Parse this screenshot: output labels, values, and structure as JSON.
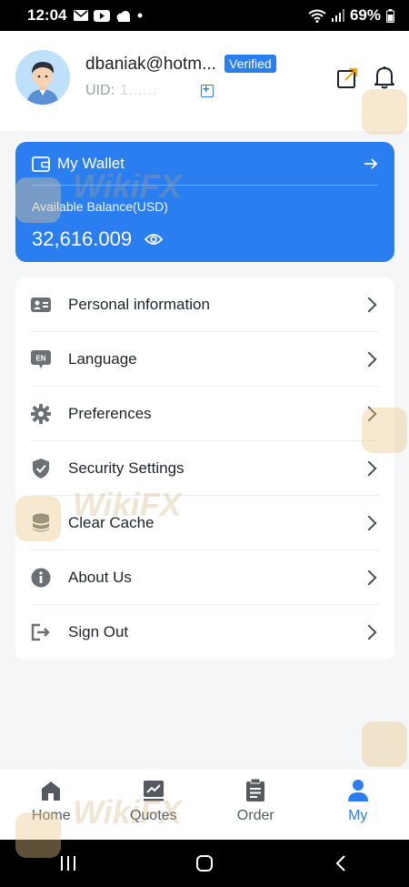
{
  "status_bar": {
    "time": "12:04",
    "battery": "69%"
  },
  "profile": {
    "email": "dbaniak@hotm...",
    "verified_label": "Verified",
    "uid_label": "UID:",
    "uid_value": "1……"
  },
  "wallet": {
    "title": "My Wallet",
    "balance_label": "Available Balance(USD)",
    "balance": "32,616.009"
  },
  "menu": {
    "items": [
      {
        "label": "Personal information",
        "icon": "id-card-icon"
      },
      {
        "label": "Language",
        "icon": "language-icon"
      },
      {
        "label": "Preferences",
        "icon": "gear-icon"
      },
      {
        "label": "Security Settings",
        "icon": "shield-icon"
      },
      {
        "label": "Clear Cache",
        "icon": "database-icon"
      },
      {
        "label": "About Us",
        "icon": "info-icon"
      },
      {
        "label": "Sign Out",
        "icon": "sign-out-icon"
      }
    ],
    "language_badge": "EN"
  },
  "bottom_nav": {
    "items": [
      {
        "label": "Home",
        "icon": "home-icon"
      },
      {
        "label": "Quotes",
        "icon": "chart-icon"
      },
      {
        "label": "Order",
        "icon": "clipboard-icon"
      },
      {
        "label": "My",
        "icon": "user-icon"
      }
    ],
    "active": "My"
  },
  "watermark": "WikiFX",
  "colors": {
    "accent": "#2b7ef0",
    "background": "#f5f6f8",
    "watermark": "#c9a86b"
  }
}
